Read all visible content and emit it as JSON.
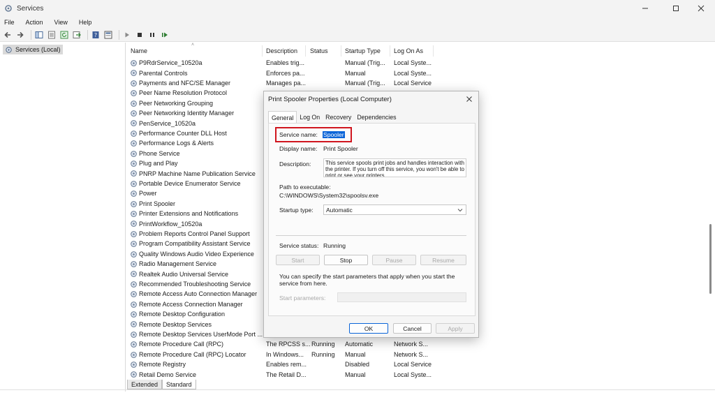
{
  "window": {
    "title": "Services"
  },
  "menu": [
    "File",
    "Action",
    "View",
    "Help"
  ],
  "tree": {
    "root_label": "Services (Local)"
  },
  "columns": [
    "Name",
    "Description",
    "Status",
    "Startup Type",
    "Log On As"
  ],
  "services": [
    {
      "name": "P9RdrService_10520a",
      "desc": "Enables trig...",
      "status": "",
      "startup": "Manual (Trig...",
      "logon": "Local Syste..."
    },
    {
      "name": "Parental Controls",
      "desc": "Enforces pa...",
      "status": "",
      "startup": "Manual",
      "logon": "Local Syste..."
    },
    {
      "name": "Payments and NFC/SE Manager",
      "desc": "Manages pa...",
      "status": "",
      "startup": "Manual (Trig...",
      "logon": "Local Service"
    },
    {
      "name": "Peer Name Resolution Protocol",
      "desc": "",
      "status": "",
      "startup": "",
      "logon": ""
    },
    {
      "name": "Peer Networking Grouping",
      "desc": "",
      "status": "",
      "startup": "",
      "logon": ""
    },
    {
      "name": "Peer Networking Identity Manager",
      "desc": "",
      "status": "",
      "startup": "",
      "logon": ""
    },
    {
      "name": "PenService_10520a",
      "desc": "",
      "status": "",
      "startup": "",
      "logon": ""
    },
    {
      "name": "Performance Counter DLL Host",
      "desc": "",
      "status": "",
      "startup": "",
      "logon": ""
    },
    {
      "name": "Performance Logs & Alerts",
      "desc": "",
      "status": "",
      "startup": "",
      "logon": ""
    },
    {
      "name": "Phone Service",
      "desc": "",
      "status": "",
      "startup": "",
      "logon": ""
    },
    {
      "name": "Plug and Play",
      "desc": "",
      "status": "",
      "startup": "",
      "logon": ""
    },
    {
      "name": "PNRP Machine Name Publication Service",
      "desc": "",
      "status": "",
      "startup": "",
      "logon": ""
    },
    {
      "name": "Portable Device Enumerator Service",
      "desc": "",
      "status": "",
      "startup": "",
      "logon": ""
    },
    {
      "name": "Power",
      "desc": "",
      "status": "",
      "startup": "",
      "logon": ""
    },
    {
      "name": "Print Spooler",
      "desc": "",
      "status": "",
      "startup": "",
      "logon": ""
    },
    {
      "name": "Printer Extensions and Notifications",
      "desc": "",
      "status": "",
      "startup": "",
      "logon": ""
    },
    {
      "name": "PrintWorkflow_10520a",
      "desc": "",
      "status": "",
      "startup": "",
      "logon": ""
    },
    {
      "name": "Problem Reports Control Panel Support",
      "desc": "",
      "status": "",
      "startup": "",
      "logon": ""
    },
    {
      "name": "Program Compatibility Assistant Service",
      "desc": "",
      "status": "",
      "startup": "",
      "logon": ""
    },
    {
      "name": "Quality Windows Audio Video Experience",
      "desc": "",
      "status": "",
      "startup": "",
      "logon": ""
    },
    {
      "name": "Radio Management Service",
      "desc": "",
      "status": "",
      "startup": "",
      "logon": ""
    },
    {
      "name": "Realtek Audio Universal Service",
      "desc": "",
      "status": "",
      "startup": "",
      "logon": ""
    },
    {
      "name": "Recommended Troubleshooting Service",
      "desc": "",
      "status": "",
      "startup": "",
      "logon": ""
    },
    {
      "name": "Remote Access Auto Connection Manager",
      "desc": "",
      "status": "",
      "startup": "",
      "logon": ""
    },
    {
      "name": "Remote Access Connection Manager",
      "desc": "",
      "status": "",
      "startup": "",
      "logon": ""
    },
    {
      "name": "Remote Desktop Configuration",
      "desc": "",
      "status": "",
      "startup": "",
      "logon": ""
    },
    {
      "name": "Remote Desktop Services",
      "desc": "",
      "status": "",
      "startup": "",
      "logon": ""
    },
    {
      "name": "Remote Desktop Services UserMode Port ...",
      "desc": "",
      "status": "",
      "startup": "",
      "logon": ""
    },
    {
      "name": "Remote Procedure Call (RPC)",
      "desc": "The RPCSS s...",
      "status": "Running",
      "startup": "Automatic",
      "logon": "Network S..."
    },
    {
      "name": "Remote Procedure Call (RPC) Locator",
      "desc": "In Windows...",
      "status": "Running",
      "startup": "Manual",
      "logon": "Network S..."
    },
    {
      "name": "Remote Registry",
      "desc": "Enables rem...",
      "status": "",
      "startup": "Disabled",
      "logon": "Local Service"
    },
    {
      "name": "Retail Demo Service",
      "desc": "The Retail D...",
      "status": "",
      "startup": "Manual",
      "logon": "Local Syste..."
    }
  ],
  "bottom_tabs": [
    "Extended",
    "Standard"
  ],
  "dialog": {
    "title": "Print Spooler Properties (Local Computer)",
    "tabs": [
      "General",
      "Log On",
      "Recovery",
      "Dependencies"
    ],
    "service_name_label": "Service name:",
    "service_name_value": "Spooler",
    "display_name_label": "Display name:",
    "display_name_value": "Print Spooler",
    "description_label": "Description:",
    "description_value": "This service spools print jobs and handles interaction with the printer.  If you turn off this service, you won't be able to print or see your printers.",
    "path_label": "Path to executable:",
    "path_value": "C:\\WINDOWS\\System32\\spoolsv.exe",
    "startup_type_label": "Startup type:",
    "startup_type_value": "Automatic",
    "service_status_label": "Service status:",
    "service_status_value": "Running",
    "start_label": "Start",
    "stop_label": "Stop",
    "pause_label": "Pause",
    "resume_label": "Resume",
    "hint_text": "You can specify the start parameters that apply when you start the service from here.",
    "start_params_label": "Start parameters:",
    "ok_label": "OK",
    "cancel_label": "Cancel",
    "apply_label": "Apply"
  }
}
